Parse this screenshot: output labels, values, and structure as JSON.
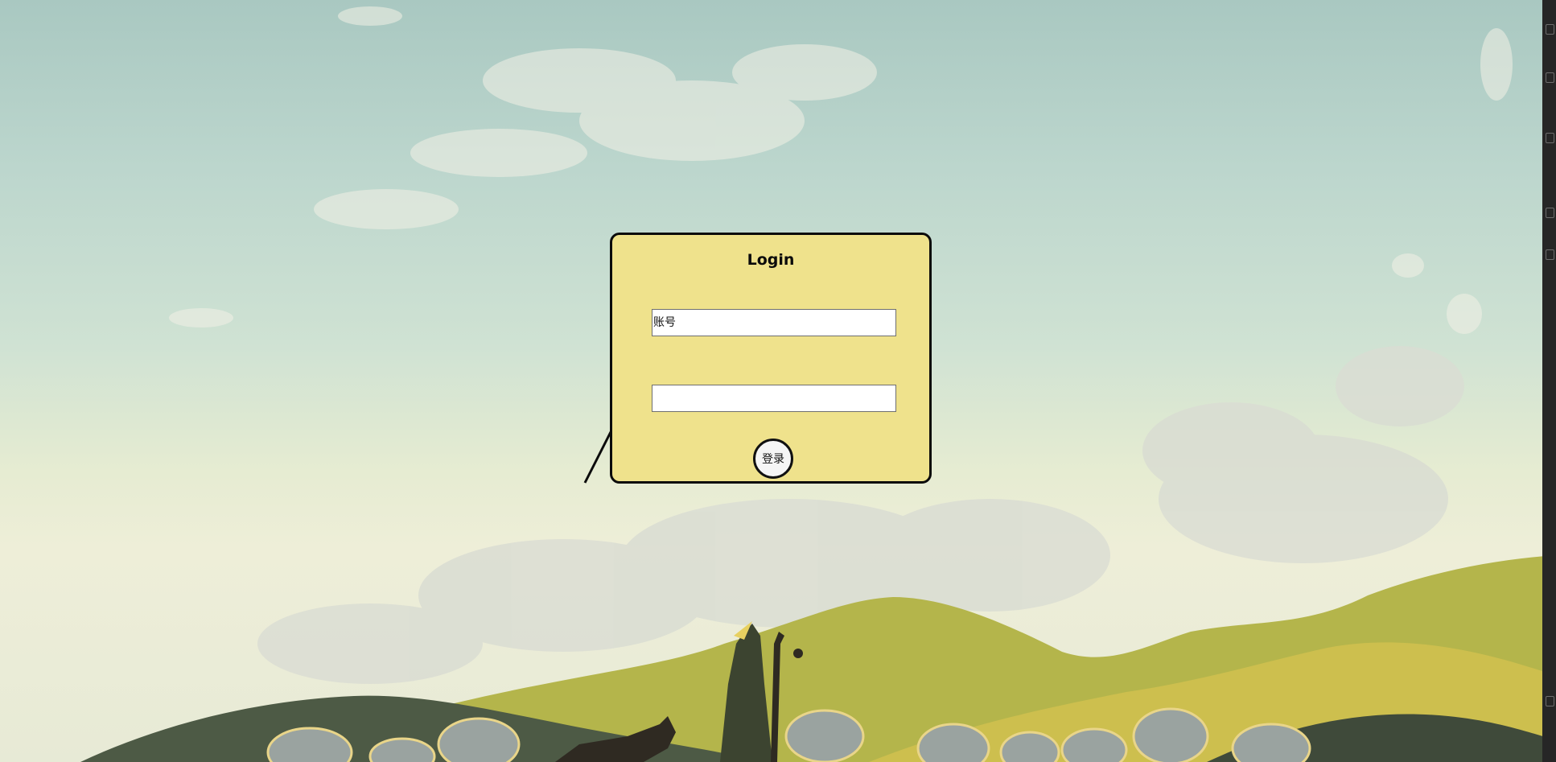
{
  "login": {
    "title": "Login",
    "account_placeholder": "账号",
    "password_placeholder": "",
    "submit_label": "登录"
  },
  "colors": {
    "panel": "#efe28c",
    "border": "#0b0b0b",
    "sky_top": "#a9c8c1",
    "sky_bottom": "#eeeed8",
    "hills": "#b7b947"
  }
}
